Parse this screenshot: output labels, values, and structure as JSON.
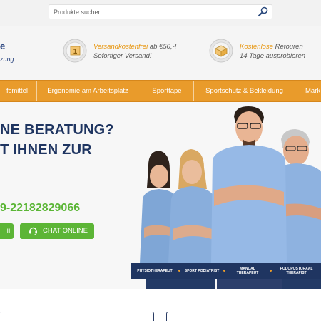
{
  "search": {
    "placeholder": "Produkte suchen"
  },
  "logo": {
    "fragment": "e",
    "subtitle_fragment": "zung"
  },
  "usp": [
    {
      "highlight": "Versandkostenfrei",
      "rest": " ab €50,-!",
      "line2": "Sofortiger Versand!",
      "icon": "truck-icon"
    },
    {
      "highlight": "Kostenlose",
      "rest": " Retouren",
      "line2": "14 Tage ausprobieren",
      "icon": "return-box-icon"
    }
  ],
  "nav": {
    "items": [
      {
        "label": "fsmittel"
      },
      {
        "label": "Ergonomie am Arbeitsplatz"
      },
      {
        "label": "Sporttape"
      },
      {
        "label": "Sportschutz & Bekleidung"
      },
      {
        "label": "Mark"
      }
    ]
  },
  "hero": {
    "line1": "NE BERATUNG?",
    "line2": "T IHNEN ZUR",
    "phone": "9-22182829066",
    "mail_button": "IL",
    "chat_button": "CHAT ONLINE"
  },
  "banner": {
    "items": [
      {
        "label": "PHYSIOTHERAPEUT"
      },
      {
        "label": "SPORT PODIATRIST"
      },
      {
        "label": "MANUAL THERAPEUT"
      },
      {
        "label": "PODOPOSTURAAL THERAPIST"
      }
    ]
  },
  "colors": {
    "brand_navy": "#1f3561",
    "nav_orange": "#e99b2b",
    "accent_green": "#5cb536",
    "usp_highlight": "#e8960e"
  }
}
